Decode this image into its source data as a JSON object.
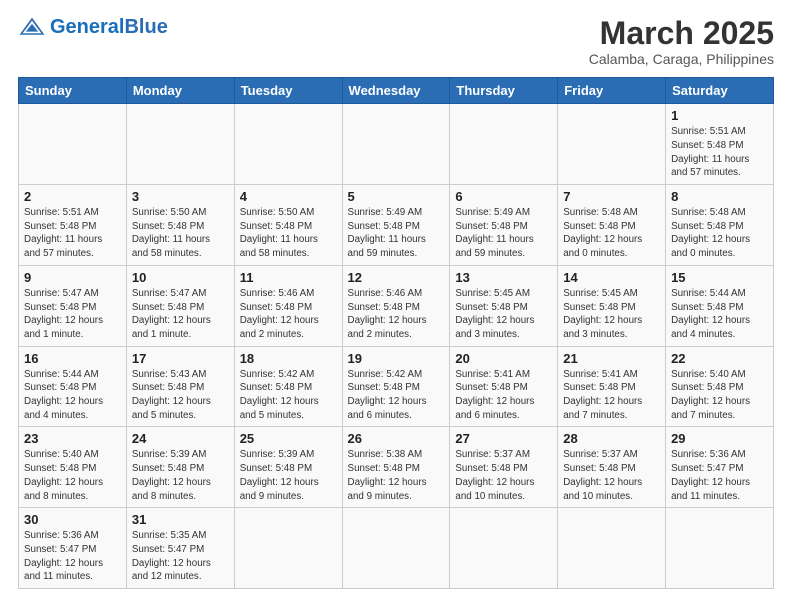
{
  "header": {
    "logo_general": "General",
    "logo_blue": "Blue",
    "month_title": "March 2025",
    "location": "Calamba, Caraga, Philippines"
  },
  "weekdays": [
    "Sunday",
    "Monday",
    "Tuesday",
    "Wednesday",
    "Thursday",
    "Friday",
    "Saturday"
  ],
  "days": {
    "1": {
      "sunrise": "5:51 AM",
      "sunset": "5:48 PM",
      "daylight": "11 hours and 57 minutes."
    },
    "2": {
      "sunrise": "5:51 AM",
      "sunset": "5:48 PM",
      "daylight": "11 hours and 57 minutes."
    },
    "3": {
      "sunrise": "5:50 AM",
      "sunset": "5:48 PM",
      "daylight": "11 hours and 58 minutes."
    },
    "4": {
      "sunrise": "5:50 AM",
      "sunset": "5:48 PM",
      "daylight": "11 hours and 58 minutes."
    },
    "5": {
      "sunrise": "5:49 AM",
      "sunset": "5:48 PM",
      "daylight": "11 hours and 59 minutes."
    },
    "6": {
      "sunrise": "5:49 AM",
      "sunset": "5:48 PM",
      "daylight": "11 hours and 59 minutes."
    },
    "7": {
      "sunrise": "5:48 AM",
      "sunset": "5:48 PM",
      "daylight": "12 hours and 0 minutes."
    },
    "8": {
      "sunrise": "5:48 AM",
      "sunset": "5:48 PM",
      "daylight": "12 hours and 0 minutes."
    },
    "9": {
      "sunrise": "5:47 AM",
      "sunset": "5:48 PM",
      "daylight": "12 hours and 1 minute."
    },
    "10": {
      "sunrise": "5:47 AM",
      "sunset": "5:48 PM",
      "daylight": "12 hours and 1 minute."
    },
    "11": {
      "sunrise": "5:46 AM",
      "sunset": "5:48 PM",
      "daylight": "12 hours and 2 minutes."
    },
    "12": {
      "sunrise": "5:46 AM",
      "sunset": "5:48 PM",
      "daylight": "12 hours and 2 minutes."
    },
    "13": {
      "sunrise": "5:45 AM",
      "sunset": "5:48 PM",
      "daylight": "12 hours and 3 minutes."
    },
    "14": {
      "sunrise": "5:45 AM",
      "sunset": "5:48 PM",
      "daylight": "12 hours and 3 minutes."
    },
    "15": {
      "sunrise": "5:44 AM",
      "sunset": "5:48 PM",
      "daylight": "12 hours and 4 minutes."
    },
    "16": {
      "sunrise": "5:44 AM",
      "sunset": "5:48 PM",
      "daylight": "12 hours and 4 minutes."
    },
    "17": {
      "sunrise": "5:43 AM",
      "sunset": "5:48 PM",
      "daylight": "12 hours and 5 minutes."
    },
    "18": {
      "sunrise": "5:42 AM",
      "sunset": "5:48 PM",
      "daylight": "12 hours and 5 minutes."
    },
    "19": {
      "sunrise": "5:42 AM",
      "sunset": "5:48 PM",
      "daylight": "12 hours and 6 minutes."
    },
    "20": {
      "sunrise": "5:41 AM",
      "sunset": "5:48 PM",
      "daylight": "12 hours and 6 minutes."
    },
    "21": {
      "sunrise": "5:41 AM",
      "sunset": "5:48 PM",
      "daylight": "12 hours and 7 minutes."
    },
    "22": {
      "sunrise": "5:40 AM",
      "sunset": "5:48 PM",
      "daylight": "12 hours and 7 minutes."
    },
    "23": {
      "sunrise": "5:40 AM",
      "sunset": "5:48 PM",
      "daylight": "12 hours and 8 minutes."
    },
    "24": {
      "sunrise": "5:39 AM",
      "sunset": "5:48 PM",
      "daylight": "12 hours and 8 minutes."
    },
    "25": {
      "sunrise": "5:39 AM",
      "sunset": "5:48 PM",
      "daylight": "12 hours and 9 minutes."
    },
    "26": {
      "sunrise": "5:38 AM",
      "sunset": "5:48 PM",
      "daylight": "12 hours and 9 minutes."
    },
    "27": {
      "sunrise": "5:37 AM",
      "sunset": "5:48 PM",
      "daylight": "12 hours and 10 minutes."
    },
    "28": {
      "sunrise": "5:37 AM",
      "sunset": "5:48 PM",
      "daylight": "12 hours and 10 minutes."
    },
    "29": {
      "sunrise": "5:36 AM",
      "sunset": "5:47 PM",
      "daylight": "12 hours and 11 minutes."
    },
    "30": {
      "sunrise": "5:36 AM",
      "sunset": "5:47 PM",
      "daylight": "12 hours and 11 minutes."
    },
    "31": {
      "sunrise": "5:35 AM",
      "sunset": "5:47 PM",
      "daylight": "12 hours and 12 minutes."
    }
  }
}
